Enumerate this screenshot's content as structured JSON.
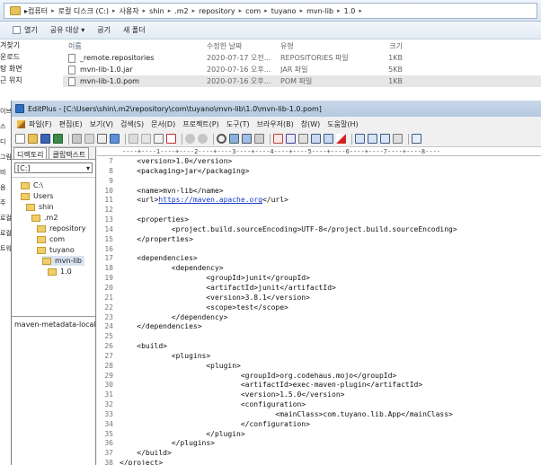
{
  "explorer": {
    "breadcrumb": [
      "컴퓨터",
      "로컬 디스크 (C:)",
      "사용자",
      "shin",
      ".m2",
      "repository",
      "com",
      "tuyano",
      "mvn-lib",
      "1.0"
    ],
    "commands": [
      "열기",
      "공유 대상 ▾",
      "굽기",
      "새 폴더"
    ],
    "nav_items": [
      "겨찾기",
      "운로드",
      "탕 화면",
      "근 위치"
    ],
    "columns": {
      "name": "이름",
      "date": "수정한 날짜",
      "type": "유형",
      "size": "크기"
    },
    "files": [
      {
        "name": "_remote.repositories",
        "date": "2020-07-17 오전...",
        "type": "REPOSITORIES 파일",
        "size": "1KB"
      },
      {
        "name": "mvn-lib-1.0.jar",
        "date": "2020-07-16 오후...",
        "type": "JAR 파일",
        "size": "5KB"
      },
      {
        "name": "mvn-lib-1.0.pom",
        "date": "2020-07-16 오후...",
        "type": "POM 파일",
        "size": "1KB"
      }
    ],
    "left_edge_labels": [
      "이브",
      "스",
      "디",
      "그림",
      "비",
      "음",
      "주",
      "로컬",
      "로컬",
      "트워"
    ]
  },
  "editplus": {
    "title": "EditPlus - [C:\\Users\\shin\\.m2\\repository\\com\\tuyano\\mvn-lib\\1.0\\mvn-lib-1.0.pom]",
    "menu": [
      "파일(F)",
      "편집(E)",
      "보기(V)",
      "검색(S)",
      "문서(D)",
      "프로젝트(P)",
      "도구(T)",
      "브라우저(B)",
      "창(W)",
      "도움말(H)"
    ],
    "left_tabs": [
      "디렉토리",
      "클립텍스트"
    ],
    "drive": "[C:]",
    "tree": [
      "C:\\",
      "Users",
      "shin",
      ".m2",
      "repository",
      "com",
      "tuyano",
      "mvn-lib",
      "1.0"
    ],
    "file_list": [
      "maven-metadata-local.xml"
    ],
    "ruler": "----+----1----+----2----+----3----+----4----+----5----+----6----+----7----+----8----",
    "code_lines": [
      {
        "n": "7",
        "text": "    <version>1.0</version>"
      },
      {
        "n": "8",
        "text": "    <packaging>jar</packaging>"
      },
      {
        "n": "9",
        "text": ""
      },
      {
        "n": "10",
        "text": "    <name>mvn-lib</name>"
      },
      {
        "n": "11",
        "text": "    <url>",
        "url": "https://maven.apache.org",
        "after": "</url>"
      },
      {
        "n": "12",
        "text": ""
      },
      {
        "n": "13",
        "text": "    <properties>"
      },
      {
        "n": "14",
        "text": "            <project.build.sourceEncoding>UTF-8</project.build.sourceEncoding>"
      },
      {
        "n": "15",
        "text": "    </properties>"
      },
      {
        "n": "16",
        "text": ""
      },
      {
        "n": "17",
        "text": "    <dependencies>"
      },
      {
        "n": "18",
        "text": "            <dependency>"
      },
      {
        "n": "19",
        "text": "                    <groupId>junit</groupId>"
      },
      {
        "n": "20",
        "text": "                    <artifactId>junit</artifactId>"
      },
      {
        "n": "21",
        "text": "                    <version>3.8.1</version>"
      },
      {
        "n": "22",
        "text": "                    <scope>test</scope>"
      },
      {
        "n": "23",
        "text": "            </dependency>"
      },
      {
        "n": "24",
        "text": "    </dependencies>"
      },
      {
        "n": "25",
        "text": ""
      },
      {
        "n": "26",
        "text": "    <build>"
      },
      {
        "n": "27",
        "text": "            <plugins>"
      },
      {
        "n": "28",
        "text": "                    <plugin>"
      },
      {
        "n": "29",
        "text": "                            <groupId>org.codehaus.mojo</groupId>"
      },
      {
        "n": "30",
        "text": "                            <artifactId>exec-maven-plugin</artifactId>"
      },
      {
        "n": "31",
        "text": "                            <version>1.5.0</version>"
      },
      {
        "n": "32",
        "text": "                            <configuration>"
      },
      {
        "n": "33",
        "text": "                                    <mainClass>com.tuyano.lib.App</mainClass>"
      },
      {
        "n": "34",
        "text": "                            </configuration>"
      },
      {
        "n": "35",
        "text": "                    </plugin>"
      },
      {
        "n": "36",
        "text": "            </plugins>"
      },
      {
        "n": "37",
        "text": "    </build>"
      },
      {
        "n": "38",
        "text": "</project>"
      }
    ]
  }
}
